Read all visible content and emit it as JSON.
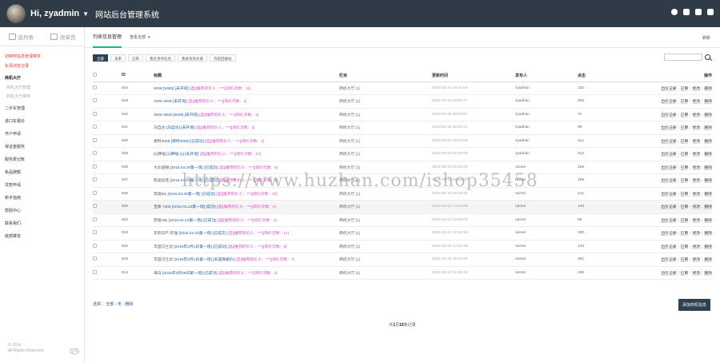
{
  "header": {
    "greeting": "Hi, zyadmin",
    "system_title": "网站后台管理系统"
  },
  "sidebar": {
    "tabs": [
      {
        "label": "选列表"
      },
      {
        "label": "改单页"
      }
    ],
    "items": [
      {
        "label": "切换到信息管理菜单",
        "style": "red"
      },
      {
        "label": "车源浏览记录",
        "style": "red"
      },
      {
        "label": "商机大厅",
        "style": "bold"
      },
      {
        "label": "商机大厅管理",
        "style": "sub"
      },
      {
        "label": "商机大厅审核",
        "style": "sub"
      },
      {
        "label": "二手车管理",
        "style": "cat"
      },
      {
        "label": "进口车报价",
        "style": "cat"
      },
      {
        "label": "开户申请",
        "style": "cat"
      },
      {
        "label": "保证金服务",
        "style": "cat"
      },
      {
        "label": "服务费记账",
        "style": "cat"
      },
      {
        "label": "免品牌额",
        "style": "cat"
      },
      {
        "label": "贷款申请",
        "style": "cat"
      },
      {
        "label": "新手指南",
        "style": "cat"
      },
      {
        "label": "帮助中心",
        "style": "cat"
      },
      {
        "label": "联系我们",
        "style": "cat"
      },
      {
        "label": "底部菜单",
        "style": "cat"
      }
    ],
    "footer_copyright": "© 2014",
    "footer_rights": "All Rights Reserved."
  },
  "main": {
    "tab_active": "列表信息管理",
    "tab_dropdown": "查看全部",
    "refresh": "刷新",
    "filters": [
      "全部",
      "未审",
      "已审",
      "我负责的任务",
      "我发布的文章",
      "内容回收站"
    ],
    "search_placeholder": "",
    "table": {
      "headers": [
        "",
        "ID",
        "标题",
        "栏目",
        "更新时间",
        "发布人",
        "点击",
        "操作"
      ],
      "rows": [
        {
          "id": "644",
          "prefix": "5008",
          "tag": "[5008] [未开询]",
          "detail": "[选][推荐的价人：***][询价次数：11]",
          "column": "商机大厅 [1]",
          "time": "2020-03-30 19:10:03",
          "user": "zyadmin",
          "clicks": "132"
        },
        {
          "id": "643",
          "prefix": "4008",
          "tag": "4008 [未开询]",
          "detail": "[选][推荐的价人：***][询价次数：2]",
          "column": "商机大厅 [1]",
          "time": "2020-03-30 19:04:47",
          "user": "zyadmin",
          "clicks": "205"
        },
        {
          "id": "642",
          "prefix": "3008",
          "tag": "3008 [3008] [未开询]",
          "detail": "[选][推荐的价人：***][询价次数：1]",
          "column": "商机大厅 [1]",
          "time": "2020-03-30 19:03:07",
          "user": "zyadmin",
          "clicks": "71"
        },
        {
          "id": "641",
          "prefix": "马自达",
          "tag": "[马自达] [未开询]",
          "detail": "[选][推荐的价人：***][询价次数：3]",
          "column": "商机大厅 [1]",
          "time": "2020-03-30 18:54:21",
          "user": "zyadmin",
          "clicks": "90"
        },
        {
          "id": "640",
          "prefix": "保时3008",
          "tag": "[保时3008] [已成功]",
          "detail": "[选][推荐的价人：***][询价次数：1]",
          "column": "商机大厅 [1]",
          "time": "2020-03-30 18:29:00",
          "user": "zyadmin",
          "clicks": "311"
        },
        {
          "id": "639",
          "prefix": "[1]神福",
          "tag": "[1]神福 [1] [未开询]",
          "detail": "[选][推荐的价人：***][询价次数：67]",
          "column": "商机大厅 [1]",
          "time": "2020-03-30 21:20:00",
          "user": "zyadmin",
          "clicks": "313"
        },
        {
          "id": "638",
          "prefix": "大众途锐",
          "tag": "[2016.04.26第一场] [已成功]",
          "detail": "[选][推荐的价人：***][询价次数：5]",
          "column": "商机大厅 [1]",
          "time": "2016-05-16 20:51:00",
          "user": "ruimei",
          "clicks": "165"
        },
        {
          "id": "637",
          "prefix": "凯迪拉克",
          "tag": "[2016.04.26第一场] [已成功]",
          "detail": "[选][推荐的价人：***][询价次数：0]",
          "column": "商机大厅 [1]",
          "time": "2016-05-16 20:50:00",
          "user": "ruimei",
          "clicks": "199"
        },
        {
          "id": "636",
          "prefix": "奔驰ML",
          "tag": "[2016.04.26第一场] [已成功]",
          "detail": "[选][推荐的价人：***][询价次数：23]",
          "column": "商机大厅 [1]",
          "time": "2016-05-16 20:49:55",
          "user": "ruimei",
          "clicks": "141"
        },
        {
          "id": "635",
          "prefix": "宝骏 7300",
          "tag": "[2016.04.22第一场] [成功]",
          "detail": "[选][推荐的价人：***][询价次数：0]",
          "column": "商机大厅 [1]",
          "time": "2016-04-22 14:00:08",
          "user": "ruimei",
          "clicks": "140"
        },
        {
          "id": "634",
          "prefix": "奔驰-ML",
          "tag": "[2016.04.22第一场] [已成功]",
          "detail": "[选][推荐的价人：***][询价次数：4]",
          "column": "商机大厅 [1]",
          "time": "2016-04-22 13:59:03",
          "user": "ruimei",
          "clicks": "69"
        },
        {
          "id": "633",
          "prefix": "东风日产 轩逸",
          "tag": "[2016.04.22第一场] [已成交]",
          "detail": "[选][推荐的价人：***][询价次数：14]",
          "column": "商机大厅 [1]",
          "time": "2016-04-22 13:45:40",
          "user": "ruimei",
          "clicks": "200"
        },
        {
          "id": "632",
          "prefix": "丰田汉兰达",
          "tag": "[2016年4月1日第一场] [已成功]",
          "detail": "[选][推荐的价人：***][询价次数：0]",
          "column": "商机大厅 [1]",
          "time": "2016-03-26 12:21:48",
          "user": "ruimei",
          "clicks": "134"
        },
        {
          "id": "615",
          "prefix": "丰田汉兰达",
          "tag": "[2016年4月1日第一场] [未选择报价]",
          "detail": "[选][推荐的价人：***][询价次数：7]",
          "column": "商机大厅 [1]",
          "time": "2016-03-26 10:44:36",
          "user": "ruimei",
          "clicks": "301"
        },
        {
          "id": "614",
          "prefix": "海马",
          "tag": "[2016年3月26日第一场] [已成功]",
          "detail": "[选][推荐的价人：***][询价次数：2]",
          "column": "商机大厅 [1]",
          "time": "2016-03-23 22:55:49",
          "user": "ruimei",
          "clicks": "165"
        }
      ],
      "ops": [
        "出价记录",
        "已审",
        "修改",
        "删除"
      ]
    },
    "bulk_label": "选择：",
    "bulk_all": "全部",
    "bulk_none": "无",
    "bulk_delete": "删除",
    "add_button": "添加商机信息",
    "pager_prefix": "共",
    "pager_pages": "1",
    "pager_mid": "页",
    "pager_records": "15",
    "pager_suffix": "条记录"
  },
  "watermark": "https://www.huzhan.com/ishop35458"
}
